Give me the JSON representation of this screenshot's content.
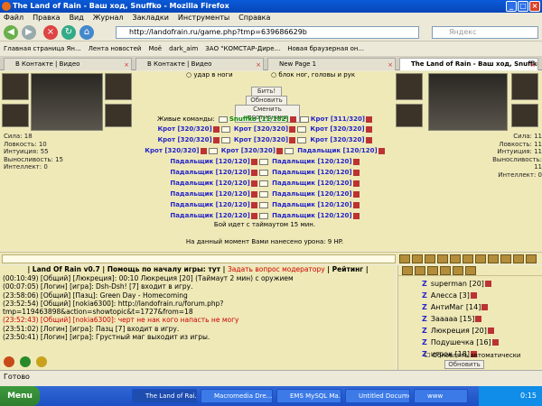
{
  "window": {
    "title": "The Land of Rain - Ваш ход, Snuffko - Mozilla Firefox"
  },
  "menu": [
    "Файл",
    "Правка",
    "Вид",
    "Журнал",
    "Закладки",
    "Инструменты",
    "Справка"
  ],
  "nav": {
    "url": "http://landofrain.ru/game.php?tmp=639686629b",
    "search_placeholder": "Яндекс"
  },
  "bookmarks": [
    "Главная страница Ян...",
    "Лента новостей",
    "Моё",
    "dark_aim",
    "ЗАО \"КОМСТАР-Дире...",
    "Новая браузерная он..."
  ],
  "tabs": [
    {
      "label": "В Контакте | Видео"
    },
    {
      "label": "В Контакте | Видео"
    },
    {
      "label": "New Page 1"
    },
    {
      "label": "The Land of Rain - Ваш ход, Snuffko"
    }
  ],
  "fight": {
    "top_options": [
      "удар в ноги",
      "блок ног, головы и рук"
    ],
    "btn_hit": "Бить!",
    "btn_refresh": "Обновить",
    "btn_change": "Сменить противника",
    "teams_label": "Живые команды:",
    "rows": [
      [
        "Snuffko [11/182]",
        "Крот [311/320]"
      ],
      [
        "Крот [320/320]",
        "Крот [320/320]",
        "Крот [320/320]"
      ],
      [
        "Крот [320/320]",
        "Крот [320/320]",
        "Крот [320/320]"
      ],
      [
        "Крот [320/320]",
        "Крот [320/320]",
        "Падальщик [120/120]"
      ],
      [
        "Падальщик [120/120]",
        "Падальщик [120/120]"
      ],
      [
        "Падальщик [120/120]",
        "Падальщик [120/120]"
      ],
      [
        "Падальщик [120/120]",
        "Падальщик [120/120]"
      ],
      [
        "Падальщик [120/120]",
        "Падальщик [120/120]"
      ],
      [
        "Падальщик [120/120]",
        "Падальщик [120/120]"
      ],
      [
        "Падальщик [120/120]",
        "Падальщик [120/120]"
      ]
    ],
    "timeout": "Бой идет с таймаутом 15 мин.",
    "damage": "На данный момент Вами нанесено урона: 9 HP."
  },
  "left_stats": [
    "Сила: 18",
    "Ловкость: 10",
    "Интуиция: 55",
    "Выносливость: 15",
    "Интеллект: 0"
  ],
  "right_stats": [
    "Сила: 11",
    "Ловкость: 11",
    "Интуиция: 11",
    "Выносливость: 11",
    "Интеллект: 0"
  ],
  "chat": {
    "header_title": "Land Of Rain v0.7",
    "header_help": "Помощь по началу игры:",
    "header_here": "тут",
    "header_ask": "Задать вопрос модератору",
    "header_rating": "Рейтинг",
    "lines": [
      "(00:10:49) [Общий] [Люкреция]: 00:10 Люкреция [20] (Таймаут 2 мин) с оружием",
      "(00:07:05) [Логин] [игра]: Dsh-Dsh! [7] входит в игру.",
      "(23:58:06) [Общий] [Пазц]: Green Day - Homecoming",
      "(23:52:54) [Общий] [nokia6300]: http://landofrain.ru/forum.php?tmp=119463898&action=showtopic&t=1727&from=18",
      "(23:52:43) [Общий] [nokia6300]: черт не нак кого напасть не могу",
      "(23:51:02) [Логин] [игра]: Пазц [7] входит в игру.",
      "(23:50:41) [Логин] [игра]: Грустный маг выходит из игры."
    ]
  },
  "users": {
    "list": [
      "superman [20]",
      "Алесса [3]",
      "АнтиМаг [14]",
      "Зааааа [15]",
      "Люкреция [20]",
      "Подушечка [16]",
      "игрок [18]"
    ],
    "auto_refresh": "Обновлять автоматически",
    "refresh_btn": "Обновить"
  },
  "status": {
    "text": "Готово"
  },
  "taskbar": {
    "start": "Menu",
    "tasks": [
      "The Land of Rai...",
      "Macromedia Dre...",
      "EMS MySQL Ma...",
      "Untitled Docume...",
      "www"
    ],
    "clock": "0:15"
  }
}
